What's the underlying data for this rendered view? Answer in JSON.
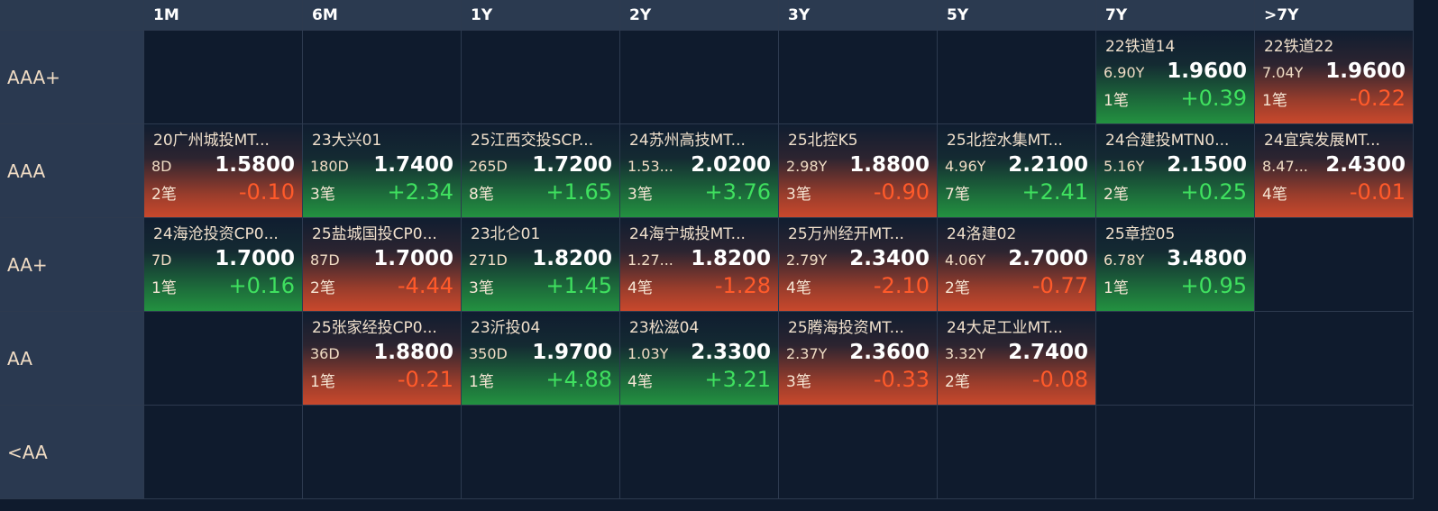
{
  "corner_label": "",
  "columns": [
    "1M",
    "6M",
    "1Y",
    "2Y",
    "3Y",
    "5Y",
    "7Y",
    ">7Y"
  ],
  "rows": [
    {
      "label": "AAA+",
      "cells": [
        null,
        null,
        null,
        null,
        null,
        null,
        {
          "name": "22铁道14",
          "tenor": "6.90Y",
          "price": "1.9600",
          "count": "1笔",
          "change": "+0.39",
          "dir": "up"
        },
        {
          "name": "22铁道22",
          "tenor": "7.04Y",
          "price": "1.9600",
          "count": "1笔",
          "change": "-0.22",
          "dir": "down"
        }
      ]
    },
    {
      "label": "AAA",
      "cells": [
        {
          "name": "20广州城投MT...",
          "tenor": "8D",
          "price": "1.5800",
          "count": "2笔",
          "change": "-0.10",
          "dir": "down"
        },
        {
          "name": "23大兴01",
          "tenor": "180D",
          "price": "1.7400",
          "count": "3笔",
          "change": "+2.34",
          "dir": "up"
        },
        {
          "name": "25江西交投SCP...",
          "tenor": "265D",
          "price": "1.7200",
          "count": "8笔",
          "change": "+1.65",
          "dir": "up"
        },
        {
          "name": "24苏州高技MT...",
          "tenor": "1.53...",
          "price": "2.0200",
          "count": "3笔",
          "change": "+3.76",
          "dir": "up"
        },
        {
          "name": "25北控K5",
          "tenor": "2.98Y",
          "price": "1.8800",
          "count": "3笔",
          "change": "-0.90",
          "dir": "down"
        },
        {
          "name": "25北控水集MT...",
          "tenor": "4.96Y",
          "price": "2.2100",
          "count": "7笔",
          "change": "+2.41",
          "dir": "up"
        },
        {
          "name": "24合建投MTN0...",
          "tenor": "5.16Y",
          "price": "2.1500",
          "count": "2笔",
          "change": "+0.25",
          "dir": "up"
        },
        {
          "name": "24宜宾发展MT...",
          "tenor": "8.47...",
          "price": "2.4300",
          "count": "4笔",
          "change": "-0.01",
          "dir": "down"
        }
      ]
    },
    {
      "label": "AA+",
      "cells": [
        {
          "name": "24海沧投资CP0...",
          "tenor": "7D",
          "price": "1.7000",
          "count": "1笔",
          "change": "+0.16",
          "dir": "up"
        },
        {
          "name": "25盐城国投CP0...",
          "tenor": "87D",
          "price": "1.7000",
          "count": "2笔",
          "change": "-4.44",
          "dir": "down"
        },
        {
          "name": "23北仑01",
          "tenor": "271D",
          "price": "1.8200",
          "count": "3笔",
          "change": "+1.45",
          "dir": "up"
        },
        {
          "name": "24海宁城投MT...",
          "tenor": "1.27...",
          "price": "1.8200",
          "count": "4笔",
          "change": "-1.28",
          "dir": "down"
        },
        {
          "name": "25万州经开MT...",
          "tenor": "2.79Y",
          "price": "2.3400",
          "count": "4笔",
          "change": "-2.10",
          "dir": "down"
        },
        {
          "name": "24洛建02",
          "tenor": "4.06Y",
          "price": "2.7000",
          "count": "2笔",
          "change": "-0.77",
          "dir": "down"
        },
        {
          "name": "25章控05",
          "tenor": "6.78Y",
          "price": "3.4800",
          "count": "1笔",
          "change": "+0.95",
          "dir": "up"
        },
        null
      ]
    },
    {
      "label": "AA",
      "cells": [
        null,
        {
          "name": "25张家经投CP0...",
          "tenor": "36D",
          "price": "1.8800",
          "count": "1笔",
          "change": "-0.21",
          "dir": "down"
        },
        {
          "name": "23沂投04",
          "tenor": "350D",
          "price": "1.9700",
          "count": "1笔",
          "change": "+4.88",
          "dir": "up"
        },
        {
          "name": "23松滋04",
          "tenor": "1.03Y",
          "price": "2.3300",
          "count": "4笔",
          "change": "+3.21",
          "dir": "up"
        },
        {
          "name": "25腾海投资MT...",
          "tenor": "2.37Y",
          "price": "2.3600",
          "count": "3笔",
          "change": "-0.33",
          "dir": "down"
        },
        {
          "name": "24大足工业MT...",
          "tenor": "3.32Y",
          "price": "2.7400",
          "count": "2笔",
          "change": "-0.08",
          "dir": "down"
        },
        null,
        null
      ]
    },
    {
      "label": "<AA",
      "cells": [
        null,
        null,
        null,
        null,
        null,
        null,
        null,
        null
      ]
    }
  ],
  "colors": {
    "background": "#0f1b2d",
    "header": "#2b3a50",
    "up_text": "#3fe05f",
    "down_text": "#ff5a2a",
    "up_fill": "#239140",
    "down_fill": "#c9482c"
  }
}
